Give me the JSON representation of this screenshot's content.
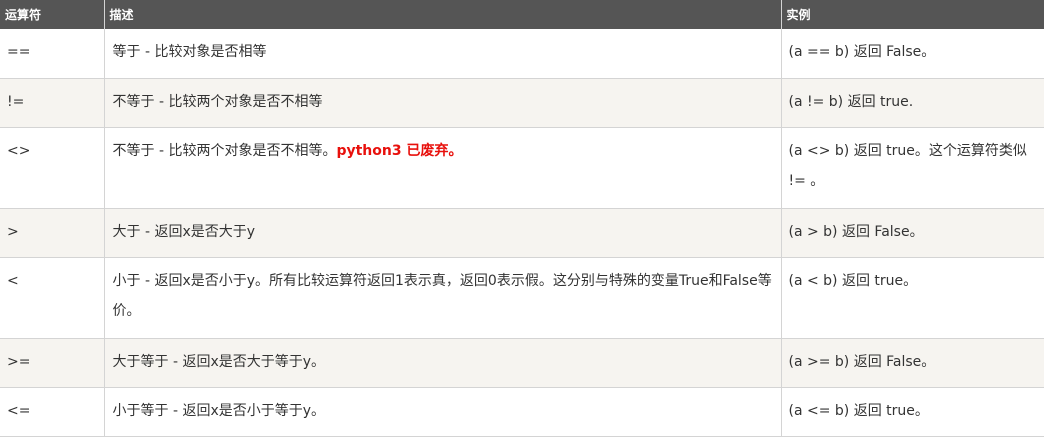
{
  "headers": {
    "operator": "运算符",
    "description": "描述",
    "example": "实例"
  },
  "rows": [
    {
      "operator": "==",
      "description": "等于 - 比较对象是否相等",
      "note": "",
      "example": "(a == b) 返回 False。"
    },
    {
      "operator": "!=",
      "description": "不等于 - 比较两个对象是否不相等",
      "note": "",
      "example": "(a != b) 返回 true."
    },
    {
      "operator": "<>",
      "description": "不等于 - 比较两个对象是否不相等。",
      "note": "python3 已废弃。",
      "example": "(a <> b) 返回 true。这个运算符类似 != 。"
    },
    {
      "operator": ">",
      "description": "大于 - 返回x是否大于y",
      "note": "",
      "example": "(a > b) 返回 False。"
    },
    {
      "operator": "<",
      "description": "小于 - 返回x是否小于y。所有比较运算符返回1表示真，返回0表示假。这分别与特殊的变量True和False等价。",
      "note": "",
      "example": "(a < b) 返回 true。"
    },
    {
      "operator": ">=",
      "description": "大于等于 - 返回x是否大于等于y。",
      "note": "",
      "example": "(a >= b) 返回 False。"
    },
    {
      "operator": "<=",
      "description": "小于等于 - 返回x是否小于等于y。",
      "note": "",
      "example": "(a <= b) 返回 true。"
    }
  ],
  "colors": {
    "header_bg": "#555555",
    "header_text": "#ffffff",
    "stripe_bg": "#f6f4f0",
    "warning_text": "#e8100c"
  }
}
